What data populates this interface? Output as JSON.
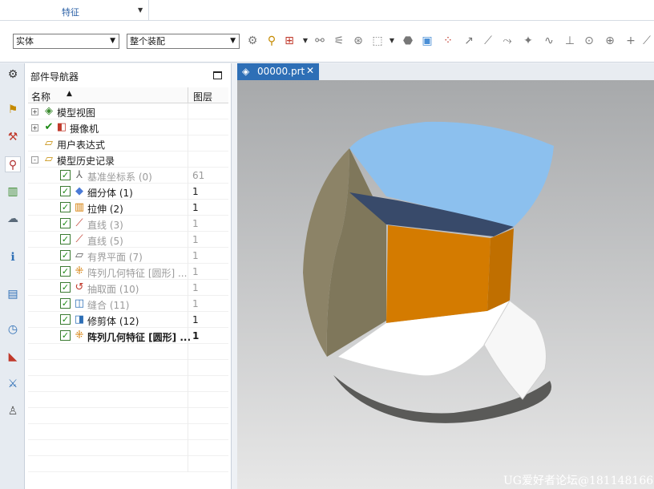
{
  "ribbon": {
    "group_label": "特征"
  },
  "toolbar": {
    "filter_type": "实体",
    "assembly_scope": "整个装配"
  },
  "navigator": {
    "title": "部件导航器",
    "columns": {
      "name": "名称",
      "layer": "图层"
    },
    "items": [
      {
        "label": "模型视图",
        "layer": "",
        "icon": "model-views-icon",
        "expander": "+",
        "checked": false,
        "dim": false,
        "bold": false
      },
      {
        "label": "摄像机",
        "layer": "",
        "icon": "camera-icon",
        "expander": "+",
        "checked": false,
        "dim": false,
        "bold": false
      },
      {
        "label": "用户表达式",
        "layer": "",
        "icon": "folder-icon",
        "expander": "",
        "checked": false,
        "dim": false,
        "bold": false
      },
      {
        "label": "模型历史记录",
        "layer": "",
        "icon": "folder-open-icon",
        "expander": "-",
        "checked": false,
        "dim": false,
        "bold": false
      },
      {
        "label": "基准坐标系 (0)",
        "layer": "61",
        "icon": "datum-csys-icon",
        "expander": "",
        "checked": true,
        "dim": true,
        "bold": false
      },
      {
        "label": "细分体 (1)",
        "layer": "1",
        "icon": "subdivision-body-icon",
        "expander": "",
        "checked": true,
        "dim": false,
        "bold": false
      },
      {
        "label": "拉伸 (2)",
        "layer": "1",
        "icon": "extrude-icon",
        "expander": "",
        "checked": true,
        "dim": false,
        "bold": false
      },
      {
        "label": "直线 (3)",
        "layer": "1",
        "icon": "line-icon",
        "expander": "",
        "checked": true,
        "dim": true,
        "bold": false
      },
      {
        "label": "直线 (5)",
        "layer": "1",
        "icon": "line-icon",
        "expander": "",
        "checked": true,
        "dim": true,
        "bold": false
      },
      {
        "label": "有界平面 (7)",
        "layer": "1",
        "icon": "bounded-plane-icon",
        "expander": "",
        "checked": true,
        "dim": true,
        "bold": false
      },
      {
        "label": "阵列几何特征 [圆形] ...",
        "layer": "1",
        "icon": "pattern-geometry-icon",
        "expander": "",
        "checked": true,
        "dim": true,
        "bold": false
      },
      {
        "label": "抽取面 (10)",
        "layer": "1",
        "icon": "extract-face-icon",
        "expander": "",
        "checked": true,
        "dim": true,
        "bold": false
      },
      {
        "label": "缝合 (11)",
        "layer": "1",
        "icon": "sew-icon",
        "expander": "",
        "checked": true,
        "dim": true,
        "bold": false
      },
      {
        "label": "修剪体 (12)",
        "layer": "1",
        "icon": "trim-body-icon",
        "expander": "",
        "checked": true,
        "dim": false,
        "bold": false
      },
      {
        "label": "阵列几何特征 [圆形] ...",
        "layer": "1",
        "icon": "pattern-geometry-icon",
        "expander": "",
        "checked": true,
        "dim": false,
        "bold": true
      }
    ]
  },
  "graphics": {
    "tab_label": "00000.prt",
    "watermark": "UG爱好者论坛@1811481669"
  },
  "colors": {
    "accent": "#2e6fb6",
    "face_blue": "#8cc0ee",
    "face_orange": "#d47b00",
    "face_olive": "#8a8060",
    "face_navy": "#384a6a"
  }
}
